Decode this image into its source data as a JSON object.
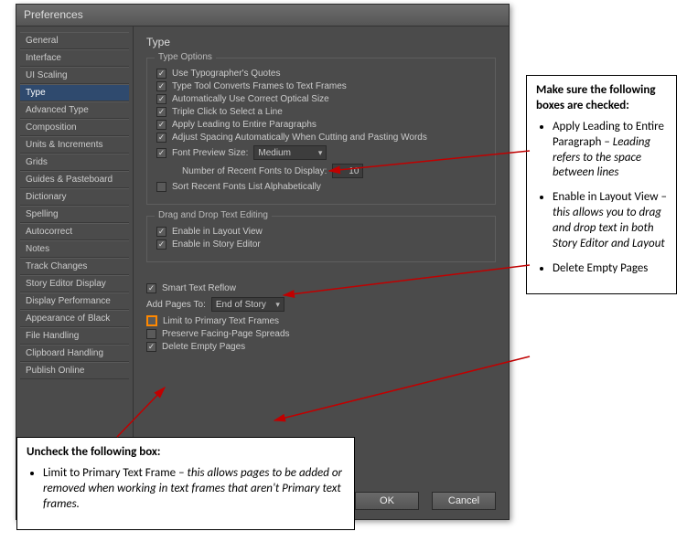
{
  "dialog": {
    "title": "Preferences"
  },
  "sidebar": {
    "items": [
      "General",
      "Interface",
      "UI Scaling",
      "Type",
      "Advanced Type",
      "Composition",
      "Units & Increments",
      "Grids",
      "Guides & Pasteboard",
      "Dictionary",
      "Spelling",
      "Autocorrect",
      "Notes",
      "Track Changes",
      "Story Editor Display",
      "Display Performance",
      "Appearance of Black",
      "File Handling",
      "Clipboard Handling",
      "Publish Online"
    ],
    "selected_index": 3
  },
  "panel": {
    "title": "Type",
    "group1_title": "Type Options",
    "opts": {
      "typographers_quotes": "Use Typographer's Quotes",
      "convert_frames": "Type Tool Converts Frames to Text Frames",
      "auto_optical": "Automatically Use Correct Optical Size",
      "triple_click": "Triple Click to Select a Line",
      "apply_leading": "Apply Leading to Entire Paragraphs",
      "adjust_spacing": "Adjust Spacing Automatically When Cutting and Pasting Words",
      "font_preview": "Font Preview Size:",
      "font_preview_value": "Medium",
      "recent_fonts_label": "Number of Recent Fonts to Display:",
      "recent_fonts_value": "10",
      "sort_recent": "Sort Recent Fonts List Alphabetically"
    },
    "group2_title": "Drag and Drop Text Editing",
    "dd_opts": {
      "layout_view": "Enable in Layout View",
      "story_editor": "Enable in Story Editor"
    },
    "reflow": {
      "smart_reflow": "Smart Text Reflow",
      "add_pages_label": "Add Pages To:",
      "add_pages_value": "End of Story",
      "limit_primary": "Limit to Primary Text Frames",
      "preserve_spreads": "Preserve Facing-Page Spreads",
      "delete_empty": "Delete Empty Pages"
    },
    "buttons": {
      "ok": "OK",
      "cancel": "Cancel"
    }
  },
  "callouts": {
    "right_title": "Make sure the following boxes are checked:",
    "right_items": {
      "a1": "Apply Leading to Entire Paragraph – ",
      "a1_em": "Leading refers to the space between lines",
      "a2": "Enable in Layout View – ",
      "a2_em": "this allows you to drag and drop text in both Story Editor and Layout",
      "a3": "Delete Empty Pages"
    },
    "bottom_title": "Uncheck the following box:",
    "bottom_items": {
      "b1": "Limit to Primary Text Frame – ",
      "b1_em": "this allows pages to be added or removed when working in text frames that aren't Primary text frames."
    }
  }
}
